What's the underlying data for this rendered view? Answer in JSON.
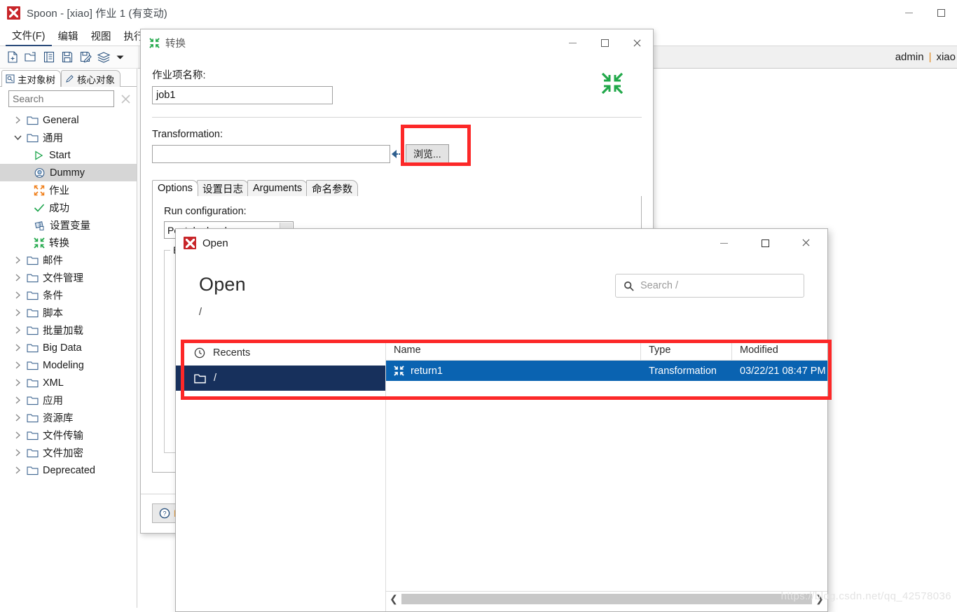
{
  "main_window": {
    "title": "Spoon - [xiao] 作业 1 (有变动)",
    "logo_icon": "spoon-logo-icon",
    "controls": {
      "minimize": "minimize-icon",
      "maximize": "maximize-icon"
    },
    "menus": [
      {
        "label": "文件(F)",
        "active": true
      },
      {
        "label": "编辑",
        "active": false
      },
      {
        "label": "视图",
        "active": false
      },
      {
        "label": "执行",
        "active": false
      }
    ],
    "toolbar_icons": [
      "new-file-icon",
      "open-folder-icon",
      "list-icon",
      "save-icon",
      "save-as-icon",
      "layers-icon",
      "chevron-down-icon"
    ],
    "user_bar": {
      "user": "admin",
      "separator": "|",
      "repository": "xiao"
    }
  },
  "left_panel": {
    "tabs": [
      {
        "label": "主对象树",
        "icon": "document-icon",
        "selected": true
      },
      {
        "label": "核心对象",
        "icon": "pencil-icon",
        "selected": false
      }
    ],
    "search": {
      "placeholder": "Search",
      "value": "",
      "clear_icon": "clear-x-icon"
    },
    "tree": [
      {
        "label": "General",
        "icon": "folder-icon",
        "chevron": "chevron-right",
        "depth": 0,
        "selected": false
      },
      {
        "label": "通用",
        "icon": "folder-icon",
        "chevron": "chevron-down",
        "depth": 0,
        "selected": false
      },
      {
        "label": "Start",
        "icon": "play-icon",
        "chevron": "none",
        "depth": 1,
        "selected": false
      },
      {
        "label": "Dummy",
        "icon": "dummy-icon",
        "chevron": "none",
        "depth": 1,
        "selected": true
      },
      {
        "label": "作业",
        "icon": "job-icon",
        "chevron": "none",
        "depth": 1,
        "selected": false
      },
      {
        "label": "成功",
        "icon": "check-icon",
        "chevron": "none",
        "depth": 1,
        "selected": false
      },
      {
        "label": "设置变量",
        "icon": "set-variable-icon",
        "chevron": "none",
        "depth": 1,
        "selected": false
      },
      {
        "label": "转换",
        "icon": "transformation-icon",
        "chevron": "none",
        "depth": 1,
        "selected": false
      },
      {
        "label": "邮件",
        "icon": "folder-icon",
        "chevron": "chevron-right",
        "depth": 0,
        "selected": false
      },
      {
        "label": "文件管理",
        "icon": "folder-icon",
        "chevron": "chevron-right",
        "depth": 0,
        "selected": false
      },
      {
        "label": "条件",
        "icon": "folder-icon",
        "chevron": "chevron-right",
        "depth": 0,
        "selected": false
      },
      {
        "label": "脚本",
        "icon": "folder-icon",
        "chevron": "chevron-right",
        "depth": 0,
        "selected": false
      },
      {
        "label": "批量加载",
        "icon": "folder-icon",
        "chevron": "chevron-right",
        "depth": 0,
        "selected": false
      },
      {
        "label": "Big Data",
        "icon": "folder-icon",
        "chevron": "chevron-right",
        "depth": 0,
        "selected": false
      },
      {
        "label": "Modeling",
        "icon": "folder-icon",
        "chevron": "chevron-right",
        "depth": 0,
        "selected": false
      },
      {
        "label": "XML",
        "icon": "folder-icon",
        "chevron": "chevron-right",
        "depth": 0,
        "selected": false
      },
      {
        "label": "应用",
        "icon": "folder-icon",
        "chevron": "chevron-right",
        "depth": 0,
        "selected": false
      },
      {
        "label": "资源库",
        "icon": "folder-icon",
        "chevron": "chevron-right",
        "depth": 0,
        "selected": false
      },
      {
        "label": "文件传输",
        "icon": "folder-icon",
        "chevron": "chevron-right",
        "depth": 0,
        "selected": false
      },
      {
        "label": "文件加密",
        "icon": "folder-icon",
        "chevron": "chevron-right",
        "depth": 0,
        "selected": false
      },
      {
        "label": "Deprecated",
        "icon": "folder-icon",
        "chevron": "chevron-right",
        "depth": 0,
        "selected": false
      }
    ]
  },
  "transformation_dialog": {
    "title": "转换",
    "title_icon": "transformation-icon",
    "corner_icon": "collapse-arrows-icon",
    "controls": {
      "minimize": "minimize-icon",
      "maximize": "maximize-icon",
      "close": "close-icon"
    },
    "job_name_label": "作业项名称:",
    "job_name_value": "job1",
    "transformation_label": "Transformation:",
    "transformation_value": "",
    "browse_button": "浏览...",
    "tabs": [
      {
        "label": "Options",
        "selected": true
      },
      {
        "label": "设置日志",
        "selected": false
      },
      {
        "label": "Arguments",
        "selected": false
      },
      {
        "label": "命名参数",
        "selected": false
      }
    ],
    "run_configuration_label": "Run configuration:",
    "run_configuration_value": "Pentaho local",
    "options_group_legend": "E",
    "help_button": "H",
    "help_icon": "question-circle-icon"
  },
  "open_dialog": {
    "title": "Open",
    "title_icon": "spoon-logo-icon",
    "controls": {
      "minimize": "minimize-icon",
      "maximize": "maximize-icon",
      "close": "close-icon"
    },
    "heading": "Open",
    "path": "/",
    "search": {
      "placeholder": "Search /",
      "value": "",
      "icon": "search-icon"
    },
    "places": [
      {
        "label": "Recents",
        "icon": "clock-icon",
        "selected": false
      },
      {
        "label": "/",
        "icon": "folder-icon",
        "selected": true
      }
    ],
    "columns": [
      "Name",
      "Type",
      "Modified"
    ],
    "rows": [
      {
        "name": "return1",
        "icon": "transformation-icon",
        "type": "Transformation",
        "modified": "03/22/21 08:47 PM",
        "selected": true
      }
    ],
    "scrollbar": {
      "left_icon": "chevron-left-icon",
      "right_icon": "chevron-right-icon"
    }
  },
  "annotations": {
    "highlight_color": "#fc2828",
    "selection_blue": "#0a63b1",
    "places_selected_navy": "#17305c"
  },
  "watermark": "https://blog.csdn.net/qq_42578036"
}
